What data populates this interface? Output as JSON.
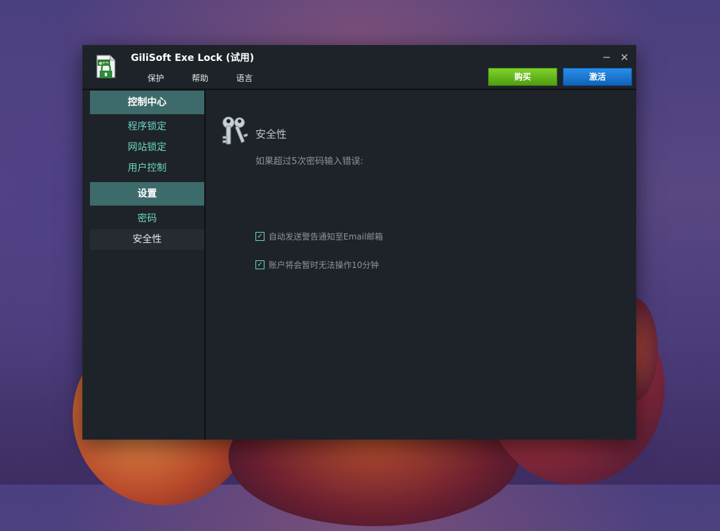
{
  "window": {
    "title": "GiliSoft Exe Lock (试用)",
    "logo_text": "exe"
  },
  "menu": [
    "保护",
    "帮助",
    "语言"
  ],
  "buttons": {
    "buy": "购买",
    "activate": "激活",
    "minimize": "─",
    "close": "✕"
  },
  "sidebar": {
    "control_center": "控制中心",
    "control_items": [
      "程序锁定",
      "网站锁定",
      "用户控制"
    ],
    "settings": "设置",
    "settings_items": [
      "密码",
      "安全性"
    ],
    "active_item": "安全性"
  },
  "content": {
    "title": "安全性",
    "description": "如果超过5次密码输入错误:",
    "options": [
      {
        "label": "自动发送警告通知至Email邮箱",
        "checked": true
      },
      {
        "label": "账户将会暂时无法操作10分钟",
        "checked": true
      }
    ]
  },
  "colors": {
    "accent_teal": "#6ad6c2",
    "header_bg": "#3d6a6a",
    "buy_green": "#5fb81a",
    "activate_blue": "#1574d0"
  }
}
